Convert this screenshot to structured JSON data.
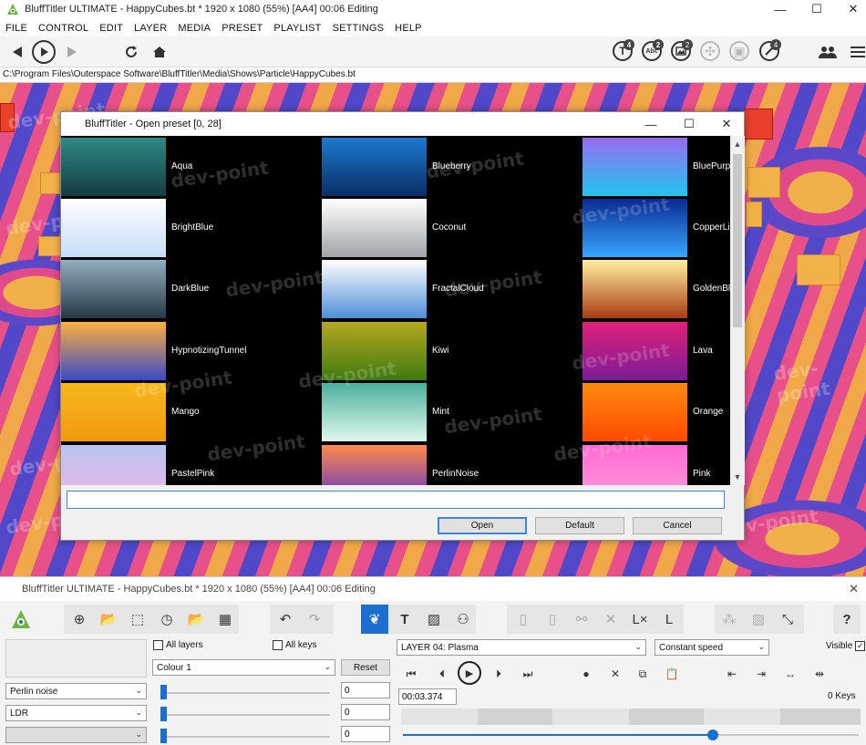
{
  "window": {
    "title": "BluffTitler ULTIMATE - HappyCubes.bt * 1920 x 1080 (55%) [AA4] 00:06 Editing",
    "minimize": "—",
    "maximize": "☐",
    "close": "✕"
  },
  "menu": [
    "FILE",
    "CONTROL",
    "EDIT",
    "LAYER",
    "MEDIA",
    "PRESET",
    "PLAYLIST",
    "SETTINGS",
    "HELP"
  ],
  "toolbar": {
    "badges": [
      "4",
      "2",
      "2",
      "4"
    ],
    "abc_label": "Abc"
  },
  "path": "C:\\Program Files\\Outerspace Software\\BluffTitler\\Media\\Shows\\Particle\\HappyCubes.bt",
  "watermark": "dev-point",
  "dialog": {
    "title": "BluffTitler - Open preset [0, 28]",
    "input_value": "",
    "buttons": {
      "open": "Open",
      "default": "Default",
      "cancel": "Cancel"
    },
    "presets": [
      {
        "name": "Aqua",
        "colors": [
          "#2f8a86",
          "#143c42"
        ]
      },
      {
        "name": "Blueberry",
        "colors": [
          "#1c7ad0",
          "#0a2e66"
        ]
      },
      {
        "name": "BluePurple",
        "colors": [
          "#9a6bf0",
          "#1fc6ee"
        ]
      },
      {
        "name": "BrightBlue",
        "colors": [
          "#ffffff",
          "#c6ddf7"
        ]
      },
      {
        "name": "Coconut",
        "colors": [
          "#ffffff",
          "#9fa4a8"
        ]
      },
      {
        "name": "CopperLine",
        "colors": [
          "#0a2a90",
          "#36a6ff"
        ]
      },
      {
        "name": "DarkBlue",
        "colors": [
          "#92aec0",
          "#263845"
        ]
      },
      {
        "name": "FractalCloud",
        "colors": [
          "#ffffff",
          "#4d8fd8"
        ]
      },
      {
        "name": "GoldenBlobs",
        "colors": [
          "#fff0a0",
          "#a83c10"
        ]
      },
      {
        "name": "HypnotizingTunnel",
        "colors": [
          "#ffb03c",
          "#3a49c8"
        ]
      },
      {
        "name": "Kiwi",
        "colors": [
          "#b4a820",
          "#3f7a10"
        ]
      },
      {
        "name": "Lava",
        "colors": [
          "#e2207a",
          "#7a1c96"
        ]
      },
      {
        "name": "Mango",
        "colors": [
          "#f5b81c",
          "#f29a10"
        ]
      },
      {
        "name": "Mint",
        "colors": [
          "#4cb09c",
          "#dff8ee"
        ]
      },
      {
        "name": "Orange",
        "colors": [
          "#ff8a10",
          "#ff4a00"
        ]
      },
      {
        "name": "PastelPink",
        "colors": [
          "#b8c4f0",
          "#f0b4e6"
        ]
      },
      {
        "name": "PerlinNoise",
        "colors": [
          "#ff8a4a",
          "#5a34c8"
        ]
      },
      {
        "name": "Pink",
        "colors": [
          "#ff6ad0",
          "#ff9ae0"
        ]
      }
    ]
  },
  "lower": {
    "title": "BluffTitler ULTIMATE - HappyCubes.bt * 1920 x 1080 (55%) [AA4] 00:06 Editing",
    "close": "✕",
    "all_layers": "All layers",
    "all_keys": "All keys",
    "colour_select": "Colour 1",
    "reset": "Reset",
    "layer_select": "LAYER 04: Plasma",
    "speed_select": "Constant speed",
    "visible": "Visible",
    "visible_check": "✓",
    "time": "00:03.374",
    "keys": "0 Keys",
    "left_selects": [
      "Perlin noise",
      "LDR",
      ""
    ],
    "values": [
      "0",
      "0",
      "0"
    ],
    "timeline_position": 0.68
  }
}
